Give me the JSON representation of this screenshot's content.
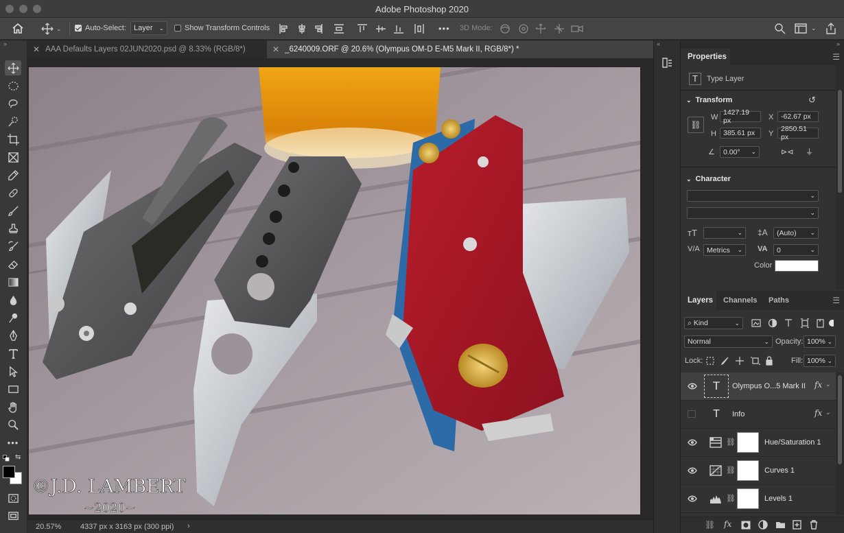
{
  "window": {
    "title": "Adobe Photoshop 2020"
  },
  "options_bar": {
    "auto_select_label": "Auto-Select:",
    "auto_select_checked": true,
    "auto_select_target": "Layer",
    "show_transform_label": "Show Transform Controls",
    "show_transform_checked": false,
    "more_label": "•••",
    "mode_3d_label": "3D Mode:"
  },
  "tabs": [
    {
      "label": "AAA Defaults Layers 02JUN2020.psd @ 8.33% (RGB/8*)",
      "active": false
    },
    {
      "label": "_6240009.ORF @ 20.6% (Olympus OM-D E-M5 Mark II, RGB/8*) *",
      "active": true
    }
  ],
  "canvas": {
    "watermark_line1": "©J.D. LAMBERT",
    "watermark_line2": "~2020~"
  },
  "status": {
    "zoom": "20.57%",
    "doc_info": "4337 px x 3163 px (300 ppi)"
  },
  "properties": {
    "title": "Properties",
    "kind": "Type Layer",
    "transform_title": "Transform",
    "w_label": "W",
    "w_value": "1427.19 px",
    "h_label": "H",
    "h_value": "385.61 px",
    "x_label": "X",
    "x_value": "-62.67 px",
    "y_label": "Y",
    "y_value": "2850.51 px",
    "angle_value": "0.00°",
    "character_title": "Character",
    "leading_value": "(Auto)",
    "kerning_value": "Metrics",
    "tracking_value": "0",
    "color_label": "Color",
    "color_value": "#ffffff"
  },
  "layers_panel": {
    "tabs": [
      "Layers",
      "Channels",
      "Paths"
    ],
    "active_tab": "Layers",
    "filter_label": "Kind",
    "blend_mode": "Normal",
    "opacity_label": "Opacity:",
    "opacity_value": "100%",
    "lock_label": "Lock:",
    "fill_label": "Fill:",
    "fill_value": "100%",
    "layers": [
      {
        "name": "Olympus O...5 Mark II",
        "type": "text",
        "visible": true,
        "fx": "fx",
        "selected": true
      },
      {
        "name": "Info",
        "type": "text",
        "visible": false,
        "fx": "fx",
        "selected": false
      },
      {
        "name": "Hue/Saturation 1",
        "type": "hue-saturation",
        "visible": true,
        "fx": "",
        "selected": false
      },
      {
        "name": "Curves 1",
        "type": "curves",
        "visible": true,
        "fx": "",
        "selected": false
      },
      {
        "name": "Levels 1",
        "type": "levels",
        "visible": true,
        "fx": "",
        "selected": false
      }
    ],
    "footer_fx": "fx"
  }
}
